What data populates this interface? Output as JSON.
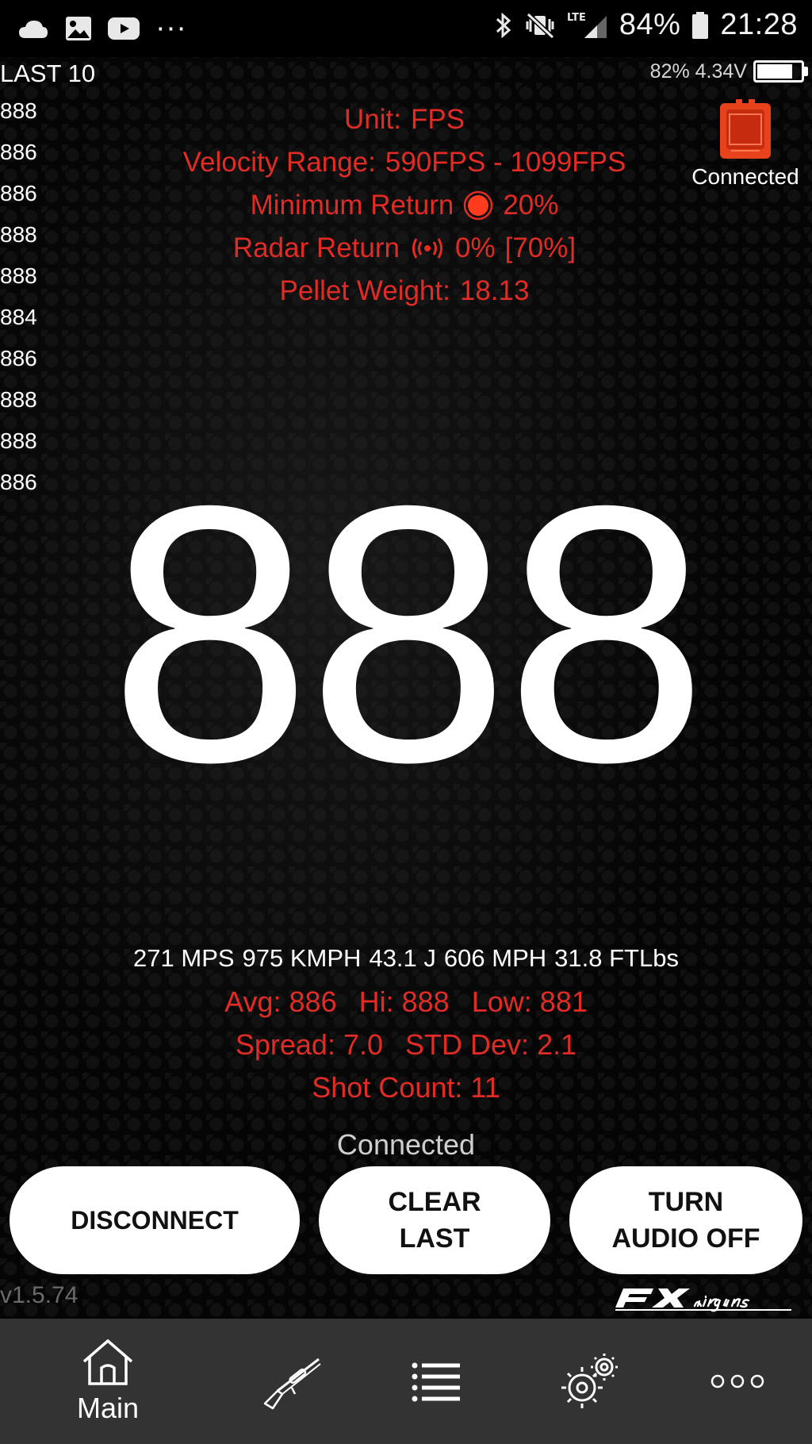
{
  "status_bar": {
    "network": "LTE",
    "battery": "84%",
    "time": "21:28",
    "more": "···"
  },
  "device_battery": {
    "percent_voltage": "82% 4.34V",
    "level": 0.82
  },
  "last10": {
    "title": "LAST 10",
    "values": [
      "888",
      "886",
      "886",
      "888",
      "888",
      "884",
      "886",
      "888",
      "888",
      "886"
    ]
  },
  "info": {
    "unit_label": "Unit:",
    "unit_value": "FPS",
    "range_label": "Velocity Range:",
    "range_value": "590FPS - 1099FPS",
    "min_return_label": "Minimum Return",
    "min_return_value": "20%",
    "radar_label": "Radar Return",
    "radar_value": "0%",
    "radar_bracket": "[70%]",
    "pellet_label": "Pellet Weight:",
    "pellet_value": "18.13"
  },
  "device": {
    "status": "Connected"
  },
  "reading": "888",
  "conversions": [
    "271 MPS",
    "975 KMPH",
    "43.1 J",
    "606 MPH",
    "31.8 FTLbs"
  ],
  "stats": {
    "avg_label": "Avg:",
    "avg": "886",
    "hi_label": "Hi:",
    "hi": "888",
    "low_label": "Low:",
    "low": "881",
    "spread_label": "Spread:",
    "spread": "7.0",
    "std_label": "STD Dev:",
    "std": "2.1",
    "count_label": "Shot Count:",
    "count": "11"
  },
  "connection_status": "Connected",
  "buttons": {
    "disconnect": "DISCONNECT",
    "clear_line1": "CLEAR",
    "clear_line2": "LAST",
    "audio_line1": "TURN",
    "audio_line2": "AUDIO OFF"
  },
  "version": "v1.5.74",
  "nav": {
    "main_label": "Main"
  },
  "colors": {
    "accent_red": "#e22b25",
    "nav_bg": "#333333",
    "button_bg": "#ffffff"
  }
}
